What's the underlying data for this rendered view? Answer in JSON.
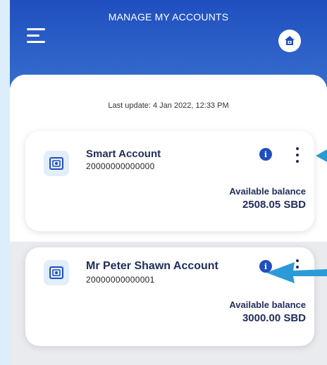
{
  "header": {
    "title": "MANAGE MY ACCOUNTS",
    "menu_icon": "hamburger-menu-icon",
    "home_icon": "home-icon"
  },
  "last_update": "Last update: 4 Jan 2022, 12:33 PM",
  "accounts": [
    {
      "name": "Smart Account",
      "number": "20000000000000",
      "balance_label": "Available balance",
      "balance": "2508.05 SBD"
    },
    {
      "name": "Mr Peter Shawn Account",
      "number": "20000000000001",
      "balance_label": "Available balance",
      "balance": "3000.00 SBD"
    }
  ],
  "colors": {
    "header_blue": "#1f4fbf",
    "text_navy": "#1f2d5a",
    "annotation_arrow": "#2c9ad6"
  }
}
